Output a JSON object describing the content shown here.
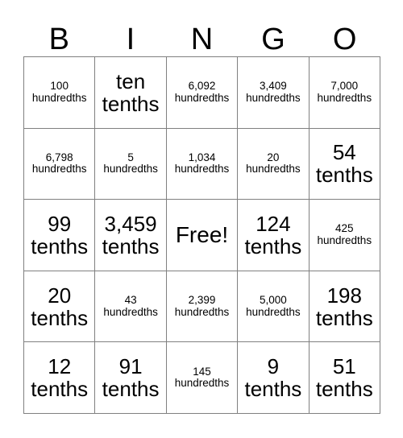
{
  "header": {
    "letters": [
      "B",
      "I",
      "N",
      "G",
      "O"
    ]
  },
  "grid": {
    "rows": 5,
    "columns": 5,
    "border_color": "#808080",
    "background_color": "#ffffff",
    "text_color": "#000000",
    "cells": [
      {
        "number": "100",
        "unit": "hundredths",
        "size": "sm"
      },
      {
        "number": "ten",
        "unit": "tenths",
        "size": "lg"
      },
      {
        "number": "6,092",
        "unit": "hundredths",
        "size": "sm"
      },
      {
        "number": "3,409",
        "unit": "hundredths",
        "size": "sm"
      },
      {
        "number": "7,000",
        "unit": "hundredths",
        "size": "sm"
      },
      {
        "number": "6,798",
        "unit": "hundredths",
        "size": "sm"
      },
      {
        "number": "5",
        "unit": "hundredths",
        "size": "sm"
      },
      {
        "number": "1,034",
        "unit": "hundredths",
        "size": "sm"
      },
      {
        "number": "20",
        "unit": "hundredths",
        "size": "sm"
      },
      {
        "number": "54",
        "unit": "tenths",
        "size": "lg"
      },
      {
        "number": "99",
        "unit": "tenths",
        "size": "lg"
      },
      {
        "number": "3,459",
        "unit": "tenths",
        "size": "lg"
      },
      {
        "number": "Free!",
        "unit": "",
        "size": "free"
      },
      {
        "number": "124",
        "unit": "tenths",
        "size": "lg"
      },
      {
        "number": "425",
        "unit": "hundredths",
        "size": "sm"
      },
      {
        "number": "20",
        "unit": "tenths",
        "size": "lg"
      },
      {
        "number": "43",
        "unit": "hundredths",
        "size": "sm"
      },
      {
        "number": "2,399",
        "unit": "hundredths",
        "size": "sm"
      },
      {
        "number": "5,000",
        "unit": "hundredths",
        "size": "sm"
      },
      {
        "number": "198",
        "unit": "tenths",
        "size": "lg"
      },
      {
        "number": "12",
        "unit": "tenths",
        "size": "lg"
      },
      {
        "number": "91",
        "unit": "tenths",
        "size": "lg"
      },
      {
        "number": "145",
        "unit": "hundredths",
        "size": "sm"
      },
      {
        "number": "9",
        "unit": "tenths",
        "size": "lg"
      },
      {
        "number": "51",
        "unit": "tenths",
        "size": "lg"
      }
    ]
  }
}
